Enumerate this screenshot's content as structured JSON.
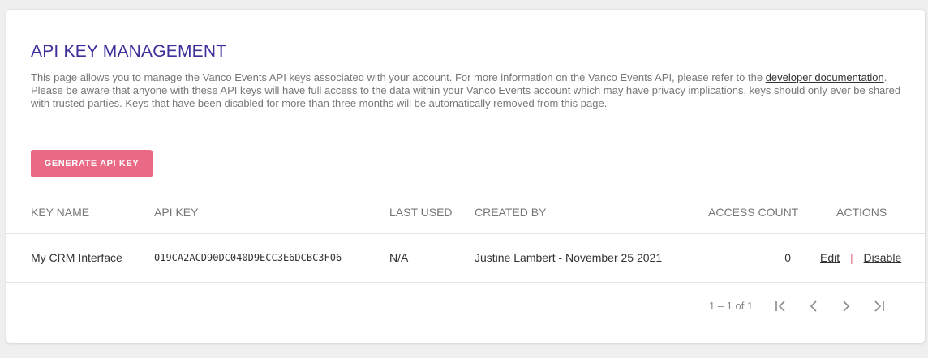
{
  "page": {
    "title": "API KEY MANAGEMENT",
    "description_part1": "This page allows you to manage the Vanco Events API keys associated with your account. For more information on the Vanco Events API, please refer to the",
    "description_link": "developer documentation",
    "description_part2": ". Please be aware that anyone with these API keys will have full access to the data within your Vanco Events account which may have privacy implications, keys should only ever be shared with trusted parties. Keys that have been disabled for more than three months will be automatically removed from this page.",
    "generate_button": "GENERATE API KEY"
  },
  "table": {
    "headers": {
      "key_name": "KEY NAME",
      "api_key": "API KEY",
      "last_used": "LAST USED",
      "created_by": "CREATED BY",
      "access_count": "ACCESS COUNT",
      "actions": "ACTIONS"
    },
    "rows": [
      {
        "key_name": "My CRM Interface",
        "api_key": "019CA2ACD90DC040D9ECC3E6DCBC3F06",
        "last_used": "N/A",
        "created_by": "Justine Lambert - November 25 2021",
        "access_count": "0",
        "edit": "Edit",
        "separator": "|",
        "disable": "Disable"
      }
    ]
  },
  "pagination": {
    "range": "1 – 1 of 1",
    "icons": [
      "first-page-icon",
      "previous-page-icon",
      "next-page-icon",
      "last-page-icon"
    ]
  },
  "colors": {
    "title": "#3d2f9a",
    "button": "#ea6a85",
    "separator": "#e06a7c"
  }
}
